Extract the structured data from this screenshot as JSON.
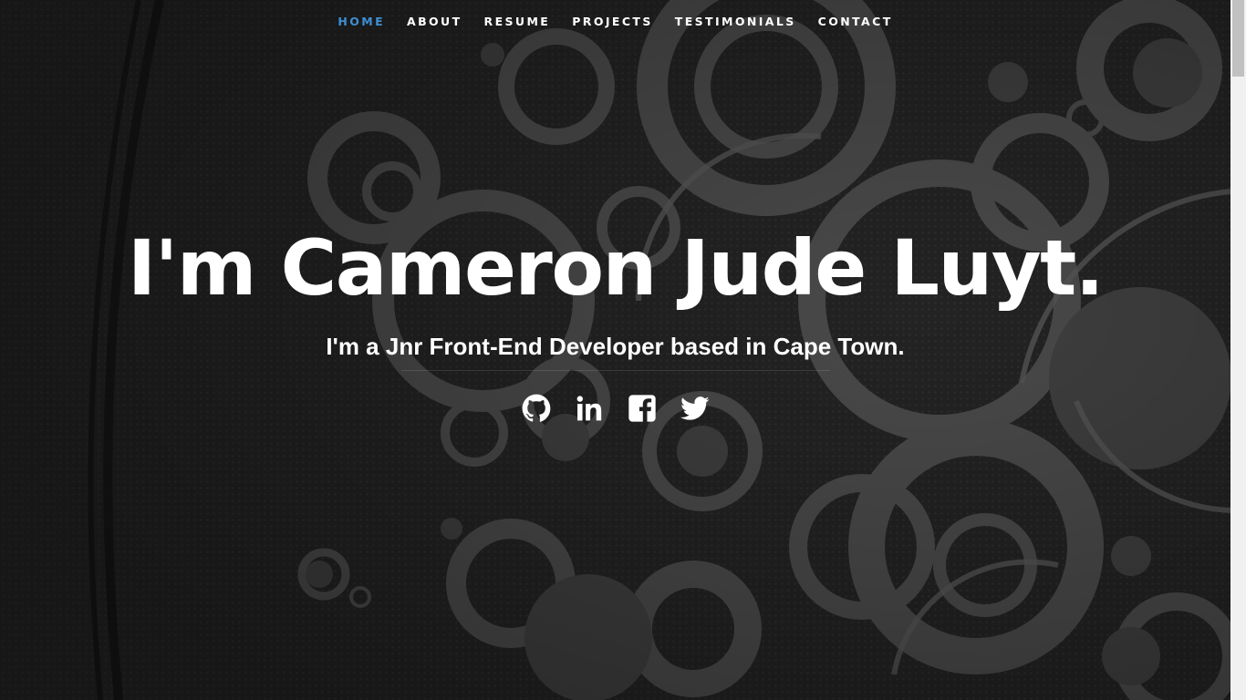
{
  "nav": {
    "items": [
      {
        "label": "HOME",
        "active": true
      },
      {
        "label": "ABOUT",
        "active": false
      },
      {
        "label": "RESUME",
        "active": false
      },
      {
        "label": "PROJECTS",
        "active": false
      },
      {
        "label": "TESTIMONIALS",
        "active": false
      },
      {
        "label": "CONTACT",
        "active": false
      }
    ],
    "active_color": "#3d8fd6"
  },
  "banner": {
    "headline": "I'm Cameron Jude Luyt.",
    "subline": "I'm a Jnr Front-End Developer based in Cape Town."
  },
  "social": [
    {
      "icon": "github-icon"
    },
    {
      "icon": "linkedin-icon"
    },
    {
      "icon": "facebook-icon"
    },
    {
      "icon": "twitter-icon"
    }
  ],
  "colors": {
    "background": "#232323",
    "text": "#ffffff"
  }
}
